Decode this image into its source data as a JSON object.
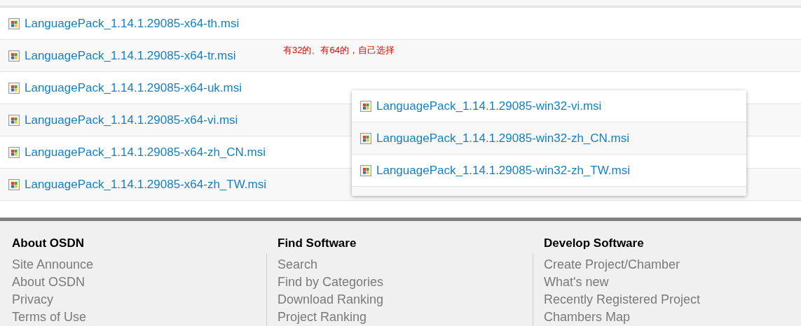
{
  "files": [
    {
      "name": "LanguagePack_1.14.1.29085-x64-th.msi"
    },
    {
      "name": "LanguagePack_1.14.1.29085-x64-tr.msi"
    },
    {
      "name": "LanguagePack_1.14.1.29085-x64-uk.msi"
    },
    {
      "name": "LanguagePack_1.14.1.29085-x64-vi.msi"
    },
    {
      "name": "LanguagePack_1.14.1.29085-x64-zh_CN.msi"
    },
    {
      "name": "LanguagePack_1.14.1.29085-x64-zh_TW.msi"
    }
  ],
  "annotation": "有32的、有64的，自己选择",
  "popup": {
    "files": [
      {
        "name": "LanguagePack_1.14.1.29085-win32-vi.msi"
      },
      {
        "name": "LanguagePack_1.14.1.29085-win32-zh_CN.msi"
      },
      {
        "name": "LanguagePack_1.14.1.29085-win32-zh_TW.msi"
      }
    ]
  },
  "footer": {
    "columns": [
      {
        "title": "About OSDN",
        "links": [
          "Site Announce",
          "About OSDN",
          "Privacy",
          "Terms of Use"
        ]
      },
      {
        "title": "Find Software",
        "links": [
          "Search",
          "Find by Categories",
          "Download Ranking",
          "Project Ranking"
        ]
      },
      {
        "title": "Develop Software",
        "links": [
          "Create Project/Chamber",
          "What's new",
          "Recently Registered Project",
          "Chambers Map"
        ]
      }
    ]
  }
}
